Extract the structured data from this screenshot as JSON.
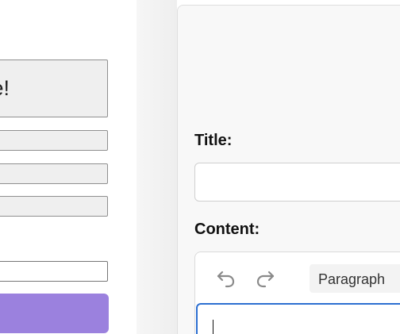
{
  "left_form": {
    "title_fragment": "e!"
  },
  "editor_panel": {
    "title_label": "Title:",
    "content_label": "Content:",
    "block_type": "Paragraph",
    "icons": {
      "undo": "undo-icon",
      "redo": "redo-icon"
    }
  },
  "colors": {
    "submit_button": "#9b81de",
    "focus_border": "#2c6fd1"
  }
}
